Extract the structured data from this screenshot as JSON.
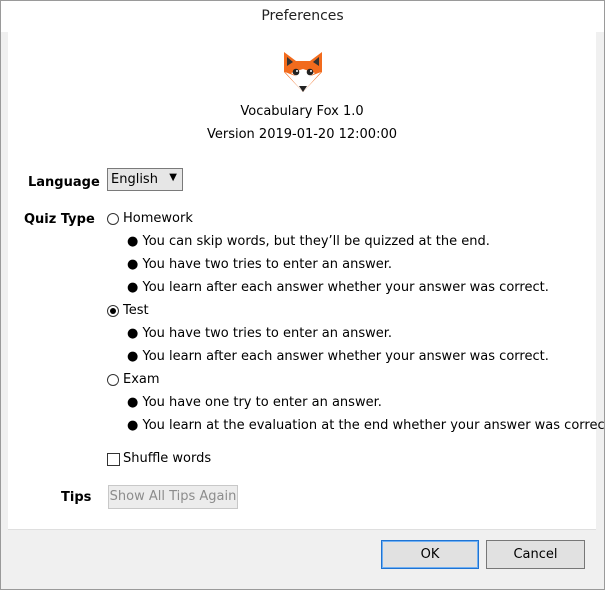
{
  "window": {
    "title": "Preferences"
  },
  "about": {
    "app_name": "Vocabulary Fox 1.0",
    "version": "Version 2019-01-20 12:00:00",
    "logo_icon": "fox-icon"
  },
  "language": {
    "label": "Language",
    "selected": "English",
    "arrow_icon": "chevron-down-icon"
  },
  "quiz_type": {
    "label": "Quiz Type",
    "options": [
      {
        "label": "Homework",
        "checked": false,
        "bullets": [
          "● You can skip words, but they’ll be quizzed at the end.",
          "● You have two tries to enter an answer.",
          "● You learn after each answer whether your answer was correct."
        ]
      },
      {
        "label": "Test",
        "checked": true,
        "bullets": [
          "● You have two tries to enter an answer.",
          "● You learn after each answer whether your answer was correct."
        ]
      },
      {
        "label": "Exam",
        "checked": false,
        "bullets": [
          "● You have one try to enter an answer.",
          "● You learn at the evaluation at the end whether your answer was correct."
        ]
      }
    ]
  },
  "shuffle": {
    "label": "Shuffle words",
    "checked": false
  },
  "tips": {
    "label": "Tips",
    "button_label": "Show All Tips Again",
    "enabled": false
  },
  "footer": {
    "ok_label": "OK",
    "cancel_label": "Cancel"
  },
  "colors": {
    "fox_orange": "#f26b1d",
    "focus_blue": "#1f73d2"
  }
}
